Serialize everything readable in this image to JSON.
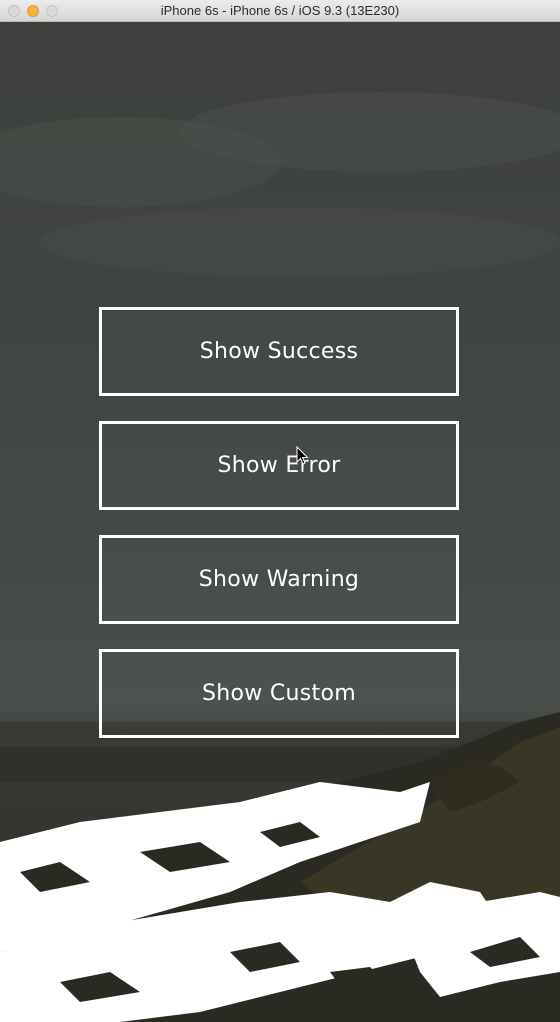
{
  "window": {
    "title": "iPhone 6s - iPhone 6s / iOS 9.3 (13E230)"
  },
  "buttons": {
    "success": "Show Success",
    "error": "Show Error",
    "warning": "Show Warning",
    "custom": "Show Custom"
  },
  "colors": {
    "button_border": "#ffffff",
    "button_text": "#ffffff",
    "background_sky": "#414541",
    "background_ground": "#2c2b24",
    "snow": "#ffffff"
  },
  "icons": {
    "pointer": "mouse-pointer-icon"
  }
}
